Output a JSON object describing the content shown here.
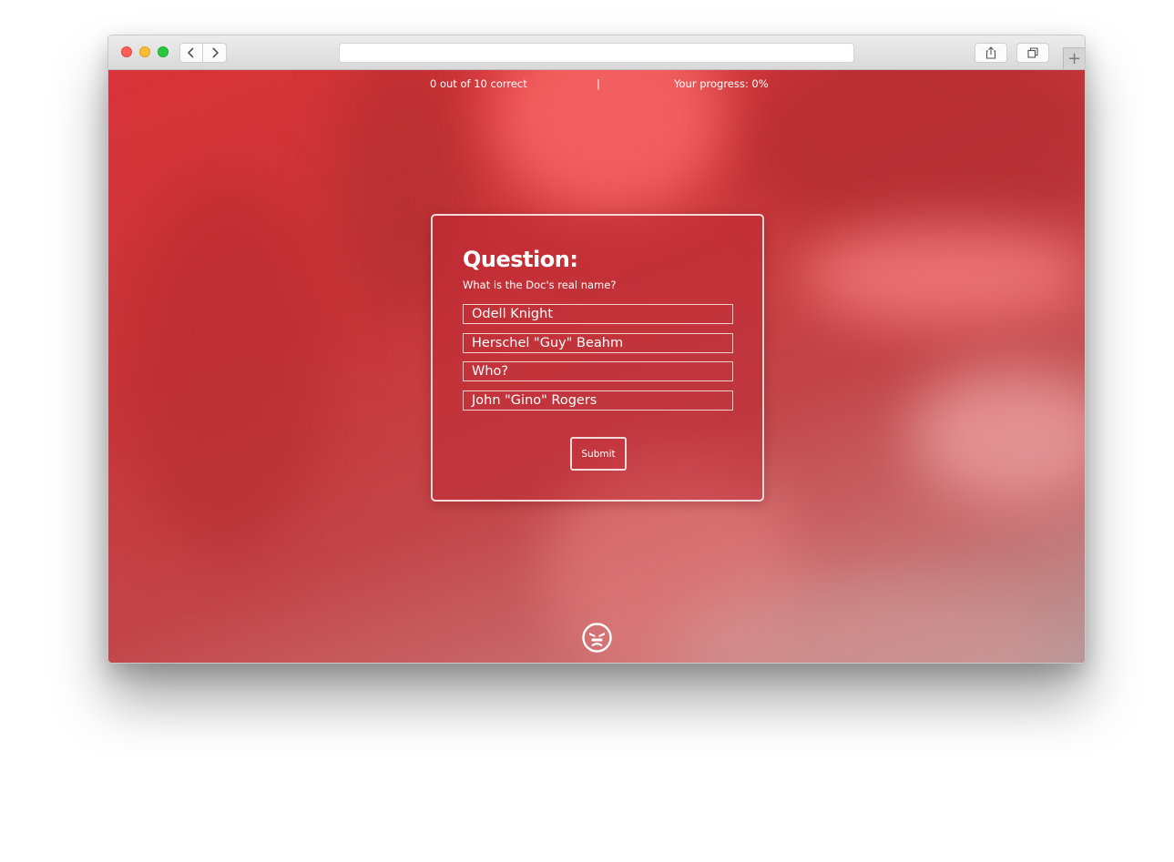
{
  "topbar": {
    "score_text": "0 out of 10 correct",
    "divider": "|",
    "progress_text": "Your progress: 0%"
  },
  "quiz": {
    "title": "Question:",
    "question": "What is the Doc's real name?",
    "answers": [
      "Odell Knight",
      "Herschel \"Guy\" Beahm",
      "Who?",
      "John \"Gino\" Rogers"
    ],
    "submit_label": "Submit"
  },
  "browser": {
    "icons": {
      "back": "chevron-left-icon",
      "forward": "chevron-right-icon",
      "share": "share-icon",
      "tabs": "tabs-icon",
      "new_tab": "plus-icon"
    },
    "new_tab_label": "+"
  },
  "footer": {
    "logo_icon": "angry-face-icon"
  },
  "colors": {
    "accent_red": "#c93639",
    "text": "#ffffff"
  }
}
